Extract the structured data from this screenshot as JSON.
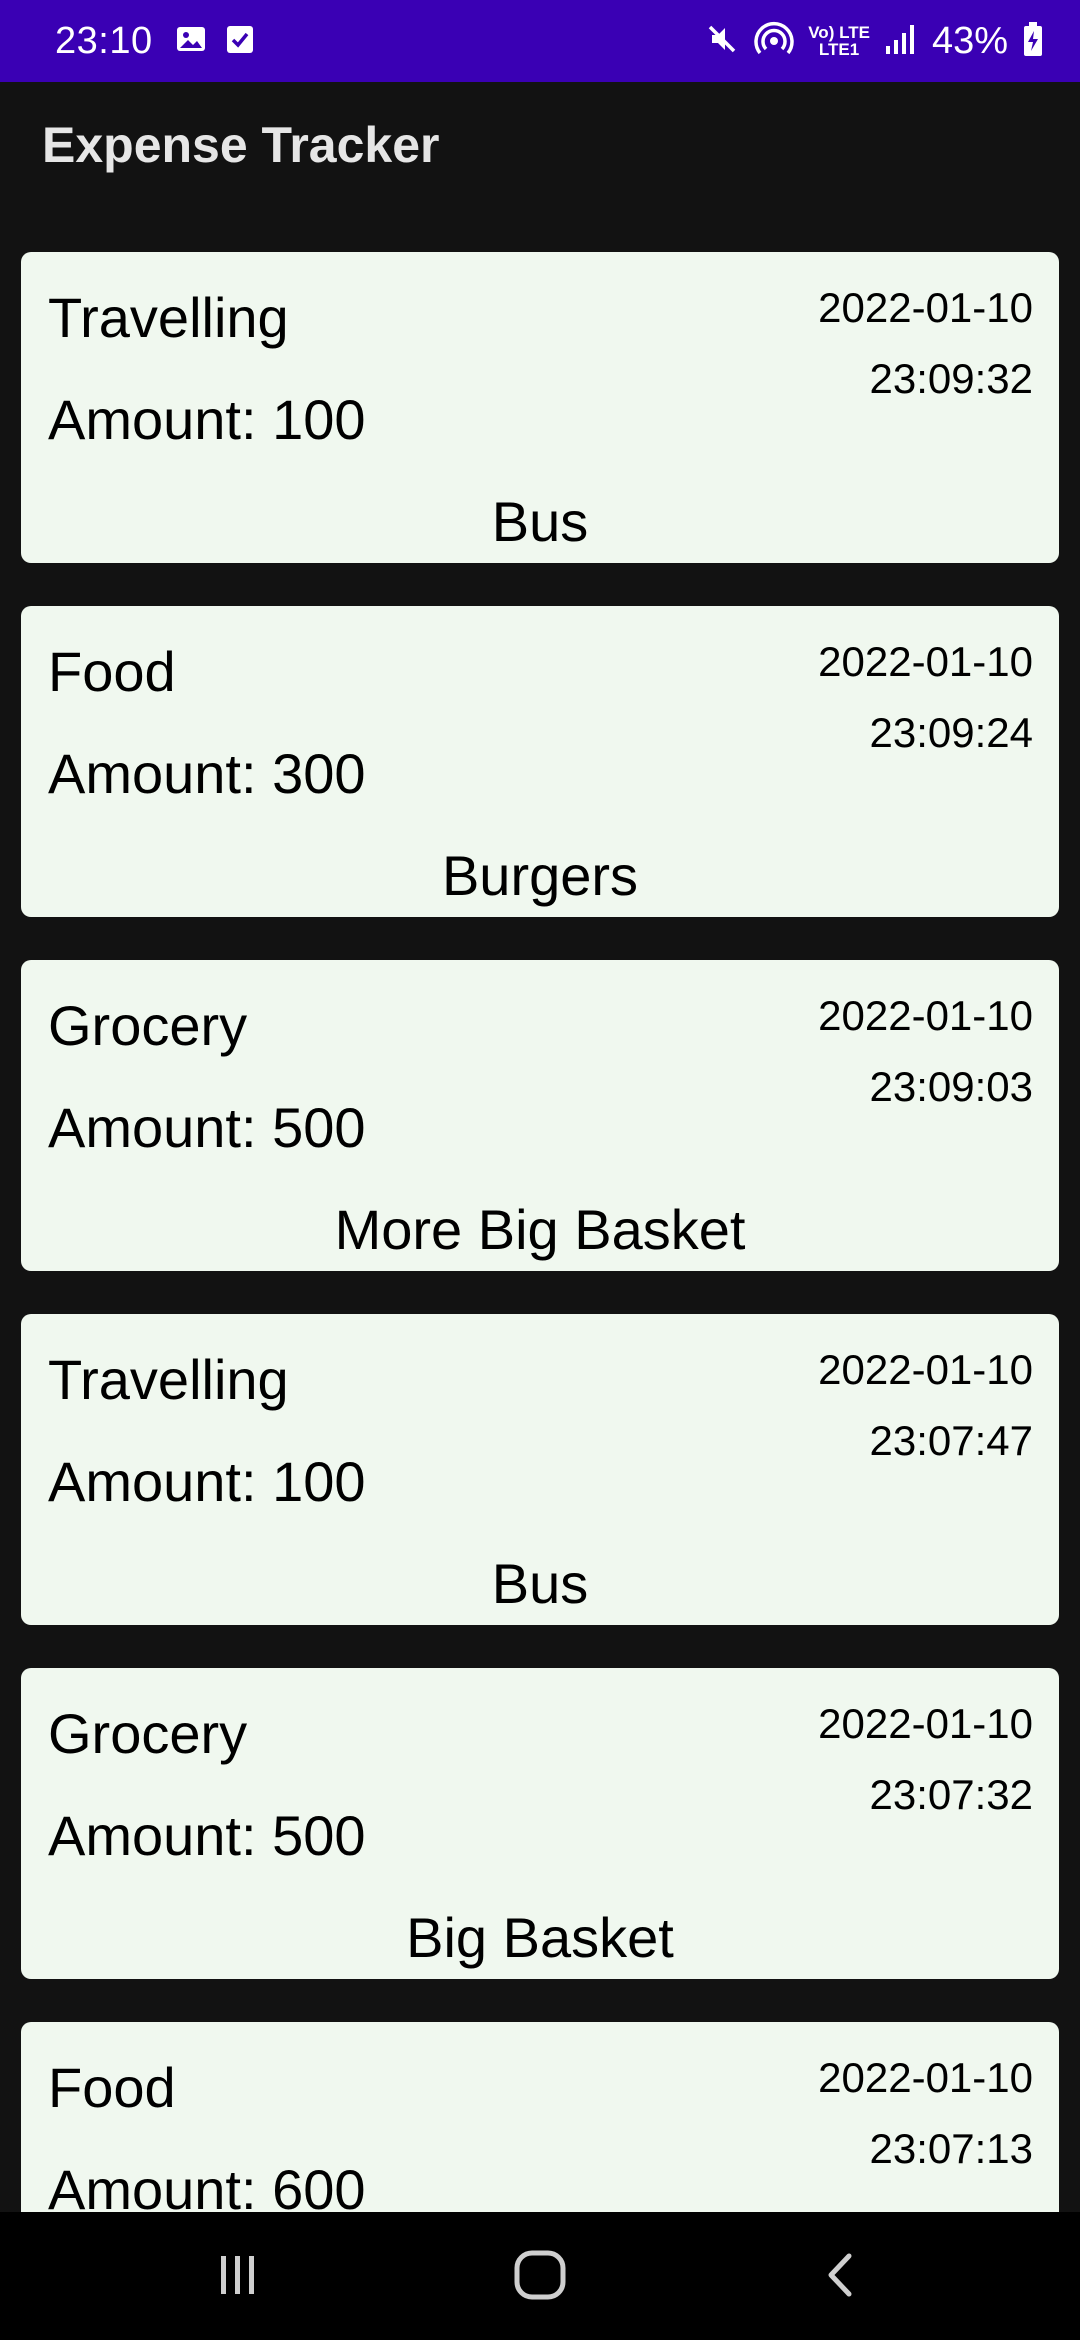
{
  "status_bar": {
    "time": "23:10",
    "battery": "43%",
    "network_top": "Vo) LTE",
    "network_bottom": "LTE1",
    "icons": [
      "image-icon",
      "check-box-icon",
      "mute-icon",
      "hotspot-icon",
      "volte-icon",
      "signal-icon",
      "battery-charging-icon"
    ]
  },
  "app_bar": {
    "title": "Expense Tracker"
  },
  "expenses": [
    {
      "category": "Travelling",
      "amount": "Amount: 100",
      "date": "2022-01-10",
      "time": "23:09:32",
      "note": "Bus"
    },
    {
      "category": "Food",
      "amount": "Amount: 300",
      "date": "2022-01-10",
      "time": "23:09:24",
      "note": "Burgers"
    },
    {
      "category": "Grocery",
      "amount": "Amount: 500",
      "date": "2022-01-10",
      "time": "23:09:03",
      "note": "More Big Basket"
    },
    {
      "category": "Travelling",
      "amount": "Amount: 100",
      "date": "2022-01-10",
      "time": "23:07:47",
      "note": "Bus"
    },
    {
      "category": "Grocery",
      "amount": "Amount: 500",
      "date": "2022-01-10",
      "time": "23:07:32",
      "note": "Big Basket"
    },
    {
      "category": "Food",
      "amount": "Amount: 600",
      "date": "2022-01-10",
      "time": "23:07:13",
      "note": ""
    }
  ],
  "nav_bar": {
    "icons": [
      "recent-apps-icon",
      "home-icon",
      "back-icon"
    ]
  },
  "colors": {
    "status_bar": "#3a00b4",
    "background": "#121212",
    "card": "#f0f8ef"
  }
}
